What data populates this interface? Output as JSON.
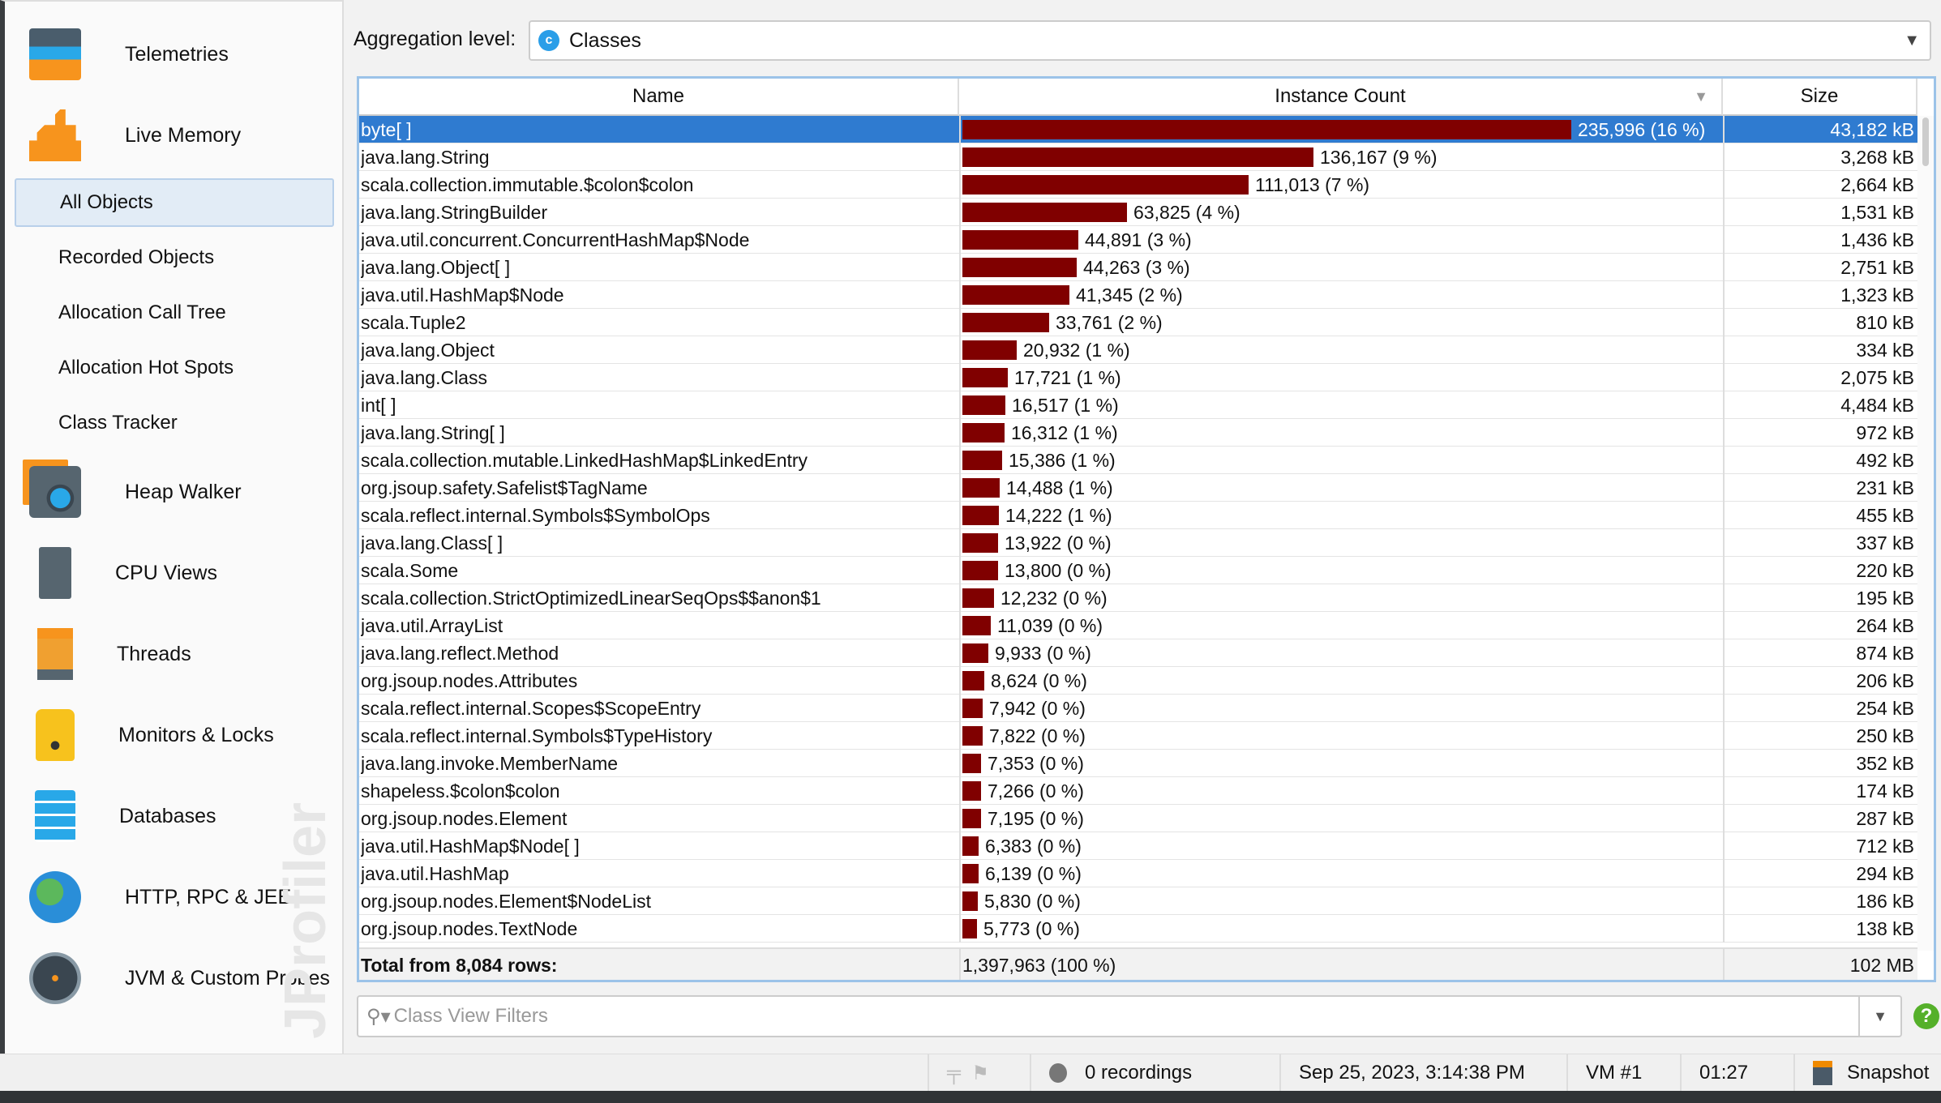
{
  "sidebar": {
    "sections": [
      {
        "label": "Telemetries",
        "icon": "telemetries-icon"
      },
      {
        "label": "Live Memory",
        "icon": "live-memory-icon"
      },
      {
        "label": "Heap Walker",
        "icon": "heap-walker-icon"
      },
      {
        "label": "CPU Views",
        "icon": "cpu-icon"
      },
      {
        "label": "Threads",
        "icon": "threads-icon"
      },
      {
        "label": "Monitors & Locks",
        "icon": "lock-icon"
      },
      {
        "label": "Databases",
        "icon": "database-icon"
      },
      {
        "label": "HTTP, RPC & JEE",
        "icon": "globe-icon"
      },
      {
        "label": "JVM & Custom Probes",
        "icon": "gauge-icon"
      }
    ],
    "subitems": [
      "All Objects",
      "Recorded Objects",
      "Allocation Call Tree",
      "Allocation Hot Spots",
      "Class Tracker"
    ],
    "selected": "All Objects",
    "watermark": "JProfiler"
  },
  "aggregation": {
    "label": "Aggregation level:",
    "value": "Classes",
    "icon_letter": "c"
  },
  "table": {
    "columns": [
      "Name",
      "Instance Count",
      "Size"
    ],
    "sort_column": "Instance Count",
    "max_count": 235996,
    "bar_color": "#800000",
    "rows": [
      [
        "byte[ ]",
        235996,
        "235,996 (16 %)",
        "43,182 kB"
      ],
      [
        "java.lang.String",
        136167,
        "136,167 (9 %)",
        "3,268 kB"
      ],
      [
        "scala.collection.immutable.$colon$colon",
        111013,
        "111,013 (7 %)",
        "2,664 kB"
      ],
      [
        "java.lang.StringBuilder",
        63825,
        "63,825 (4 %)",
        "1,531 kB"
      ],
      [
        "java.util.concurrent.ConcurrentHashMap$Node",
        44891,
        "44,891 (3 %)",
        "1,436 kB"
      ],
      [
        "java.lang.Object[ ]",
        44263,
        "44,263 (3 %)",
        "2,751 kB"
      ],
      [
        "java.util.HashMap$Node",
        41345,
        "41,345 (2 %)",
        "1,323 kB"
      ],
      [
        "scala.Tuple2",
        33761,
        "33,761 (2 %)",
        "810 kB"
      ],
      [
        "java.lang.Object",
        20932,
        "20,932 (1 %)",
        "334 kB"
      ],
      [
        "java.lang.Class",
        17721,
        "17,721 (1 %)",
        "2,075 kB"
      ],
      [
        "int[ ]",
        16517,
        "16,517 (1 %)",
        "4,484 kB"
      ],
      [
        "java.lang.String[ ]",
        16312,
        "16,312 (1 %)",
        "972 kB"
      ],
      [
        "scala.collection.mutable.LinkedHashMap$LinkedEntry",
        15386,
        "15,386 (1 %)",
        "492 kB"
      ],
      [
        "org.jsoup.safety.Safelist$TagName",
        14488,
        "14,488 (1 %)",
        "231 kB"
      ],
      [
        "scala.reflect.internal.Symbols$SymbolOps",
        14222,
        "14,222 (1 %)",
        "455 kB"
      ],
      [
        "java.lang.Class[ ]",
        13922,
        "13,922 (0 %)",
        "337 kB"
      ],
      [
        "scala.Some",
        13800,
        "13,800 (0 %)",
        "220 kB"
      ],
      [
        "scala.collection.StrictOptimizedLinearSeqOps$$anon$1",
        12232,
        "12,232 (0 %)",
        "195 kB"
      ],
      [
        "java.util.ArrayList",
        11039,
        "11,039 (0 %)",
        "264 kB"
      ],
      [
        "java.lang.reflect.Method",
        9933,
        "9,933 (0 %)",
        "874 kB"
      ],
      [
        "org.jsoup.nodes.Attributes",
        8624,
        "8,624 (0 %)",
        "206 kB"
      ],
      [
        "scala.reflect.internal.Scopes$ScopeEntry",
        7942,
        "7,942 (0 %)",
        "254 kB"
      ],
      [
        "scala.reflect.internal.Symbols$TypeHistory",
        7822,
        "7,822 (0 %)",
        "250 kB"
      ],
      [
        "java.lang.invoke.MemberName",
        7353,
        "7,353 (0 %)",
        "352 kB"
      ],
      [
        "shapeless.$colon$colon",
        7266,
        "7,266 (0 %)",
        "174 kB"
      ],
      [
        "org.jsoup.nodes.Element",
        7195,
        "7,195 (0 %)",
        "287 kB"
      ],
      [
        "java.util.HashMap$Node[ ]",
        6383,
        "6,383 (0 %)",
        "712 kB"
      ],
      [
        "java.util.HashMap",
        6139,
        "6,139 (0 %)",
        "294 kB"
      ],
      [
        "org.jsoup.nodes.Element$NodeList",
        5830,
        "5,830 (0 %)",
        "186 kB"
      ],
      [
        "org.jsoup.nodes.TextNode",
        5773,
        "5,773 (0 %)",
        "138 kB"
      ]
    ],
    "total": {
      "label": "Total from 8,084 rows:",
      "count": "1,397,963 (100 %)",
      "size": "102 MB"
    }
  },
  "filter": {
    "placeholder": "Class View Filters"
  },
  "status": {
    "recordings": "0 recordings",
    "datetime": "Sep 25, 2023, 3:14:38 PM",
    "vm": "VM #1",
    "elapsed": "01:27",
    "snapshot": "Snapshot"
  }
}
